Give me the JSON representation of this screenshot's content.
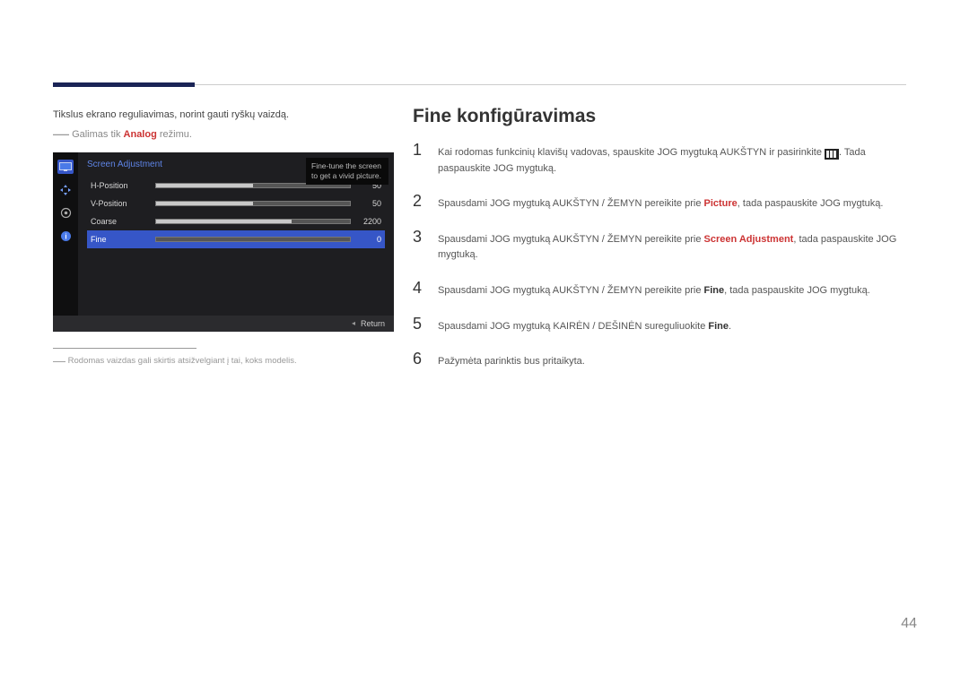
{
  "page_number": "44",
  "heading": "Fine konfigūravimas",
  "left": {
    "intro": "Tikslus ekrano reguliavimas, norint gauti ryškų vaizdą.",
    "note_pre": "Galimas tik ",
    "note_bold": "Analog",
    "note_post": " režimu.",
    "footnote": "Rodomas vaizdas gali skirtis atsižvelgiant į tai, koks modelis."
  },
  "screenshot": {
    "title": "Screen Adjustment",
    "tooltip": "Fine-tune the screen to get a vivid picture.",
    "rows": [
      {
        "label": "H-Position",
        "value": "50",
        "fill_pct": 50,
        "selected": false
      },
      {
        "label": "V-Position",
        "value": "50",
        "fill_pct": 50,
        "selected": false
      },
      {
        "label": "Coarse",
        "value": "2200",
        "fill_pct": 70,
        "selected": false
      },
      {
        "label": "Fine",
        "value": "0",
        "fill_pct": 0,
        "selected": true
      }
    ],
    "return_label": "Return"
  },
  "steps": {
    "s1a": "Kai rodomas funkcinių klavišų vadovas, spauskite JOG mygtuką AUKŠTYN ir pasirinkite ",
    "s1b": ". Tada paspauskite JOG mygtuką.",
    "s2a": "Spausdami JOG mygtuką AUKŠTYN / ŽEMYN pereikite prie ",
    "s2_picture": "Picture",
    "s2b": ", tada paspauskite JOG mygtuką.",
    "s3a": "Spausdami JOG mygtuką AUKŠTYN / ŽEMYN pereikite prie ",
    "s3_sa": "Screen Adjustment",
    "s3b": ", tada paspauskite JOG mygtuką.",
    "s4a": "Spausdami JOG mygtuką AUKŠTYN / ŽEMYN pereikite prie ",
    "s4_fine": "Fine",
    "s4b": ", tada paspauskite JOG mygtuką.",
    "s5a": "Spausdami JOG mygtuką KAIRĖN / DEŠINĖN sureguliuokite ",
    "s5_fine": "Fine",
    "s5b": ".",
    "s6": "Pažymėta parinktis bus pritaikyta."
  }
}
